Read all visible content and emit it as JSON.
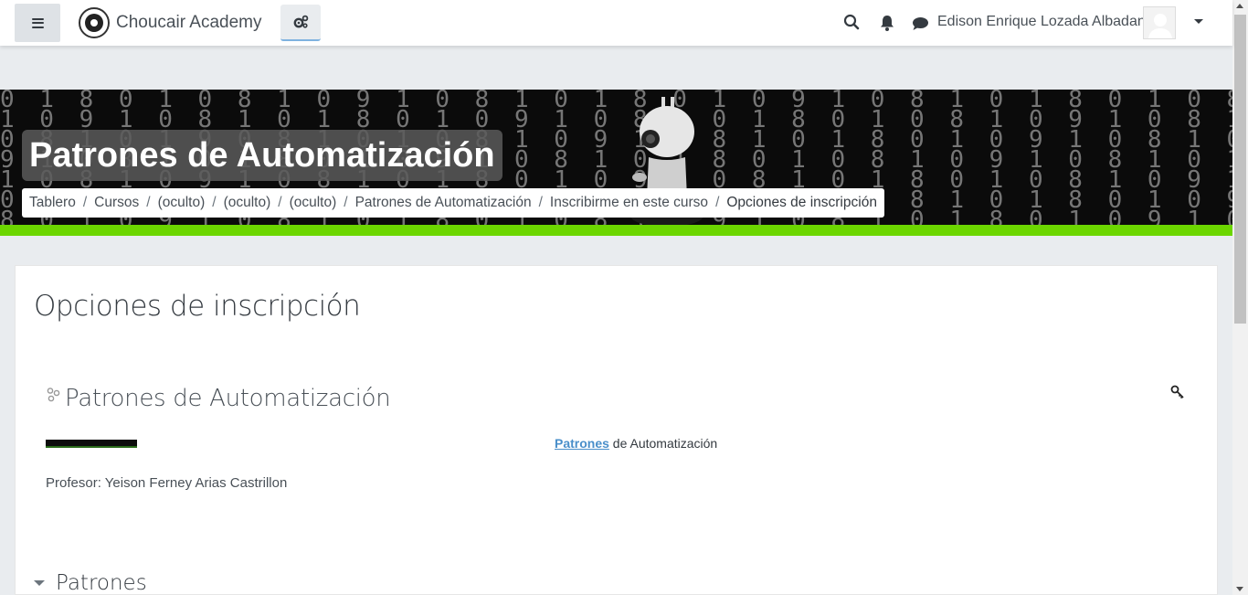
{
  "navbar": {
    "brand": "Choucair Academy",
    "user_name": "Edison Enrique Lozada Albadan",
    "icons": [
      "menu-icon",
      "settings-icon",
      "search-icon",
      "bell-icon",
      "message-icon",
      "caret-down-icon"
    ]
  },
  "header": {
    "page_title": "Patrones de Automatización",
    "breadcrumbs": [
      "Tablero",
      "Cursos",
      "(oculto)",
      "(oculto)",
      "(oculto)",
      "Patrones de Automatización",
      "Inscribirme en este curso",
      "Opciones de inscripción"
    ],
    "separator": "/"
  },
  "main": {
    "heading": "Opciones de inscripción",
    "course": {
      "title": "Patrones de Automatización",
      "summary_link": "Patrones",
      "summary_rest": " de Automatización",
      "teacher_label": "Profesor:",
      "teacher_name": "Yeison Ferney Arias Castrillon"
    },
    "section": {
      "label": "Patrones"
    }
  },
  "colors": {
    "accent_green": "#6cd600",
    "link_blue": "#4a8fca",
    "page_bg": "#e9ecef"
  }
}
